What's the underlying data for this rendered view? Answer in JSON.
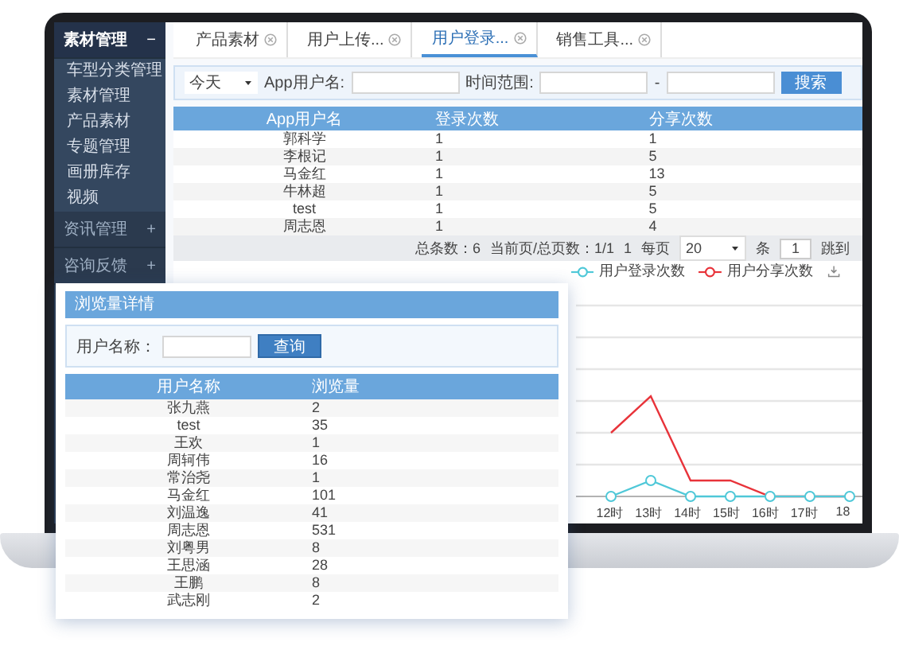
{
  "sidebar": {
    "groups": [
      {
        "label": "素材管理",
        "toggle": "−",
        "expanded": true,
        "children": [
          {
            "label": "车型分类管理"
          },
          {
            "label": "素材管理"
          },
          {
            "label": "产品素材"
          },
          {
            "label": "专题管理"
          },
          {
            "label": "画册库存"
          },
          {
            "label": "视频"
          }
        ]
      },
      {
        "label": "资讯管理",
        "toggle": "+",
        "expanded": false
      },
      {
        "label": "咨询反馈",
        "toggle": "+",
        "expanded": false
      }
    ]
  },
  "tabs": [
    {
      "label": "产品素材",
      "selected": false
    },
    {
      "label": "用户上传...",
      "selected": false
    },
    {
      "label": "用户登录...",
      "selected": true
    },
    {
      "label": "销售工具...",
      "selected": false
    }
  ],
  "filter": {
    "period": "今天",
    "username_label": "App用户名:",
    "range_label": "时间范围:",
    "range_separator": "-",
    "search_button": "搜索"
  },
  "table": {
    "columns": [
      "App用户名",
      "登录次数",
      "分享次数"
    ],
    "rows": [
      [
        "郭科学",
        "1",
        "1"
      ],
      [
        "李根记",
        "1",
        "5"
      ],
      [
        "马金红",
        "1",
        "13"
      ],
      [
        "牛林超",
        "1",
        "5"
      ],
      [
        "test",
        "1",
        "5"
      ],
      [
        "周志恩",
        "1",
        "4"
      ]
    ]
  },
  "pagination": {
    "total": "总条数：6",
    "page_info": "当前页/总页数：1/1",
    "page": "1",
    "per_page_label": "每页",
    "per_page": "20",
    "unit": "条",
    "jump_value": "1",
    "jump_button": "跳到"
  },
  "chart": {
    "legend": [
      {
        "label": "用户登录次数",
        "color": "#4fc8d8"
      },
      {
        "label": "用户分享次数",
        "color": "#e8333a"
      }
    ],
    "x_labels": [
      "12时",
      "13时",
      "14时",
      "15时",
      "16时",
      "17时",
      "18"
    ]
  },
  "popup": {
    "title": "浏览量详情",
    "search_label": "用户名称：",
    "search_button": "查询",
    "columns": [
      "用户名称",
      "浏览量"
    ],
    "rows": [
      [
        "张九燕",
        "2"
      ],
      [
        "test",
        "35"
      ],
      [
        "王欢",
        "1"
      ],
      [
        "周轲伟",
        "16"
      ],
      [
        "常治尧",
        "1"
      ],
      [
        "马金红",
        "101"
      ],
      [
        "刘温逸",
        "41"
      ],
      [
        "周志恩",
        "531"
      ],
      [
        "刘粤男",
        "8"
      ],
      [
        "王思涵",
        "28"
      ],
      [
        "王鹏",
        "8"
      ],
      [
        "武志刚",
        "2"
      ]
    ]
  }
}
